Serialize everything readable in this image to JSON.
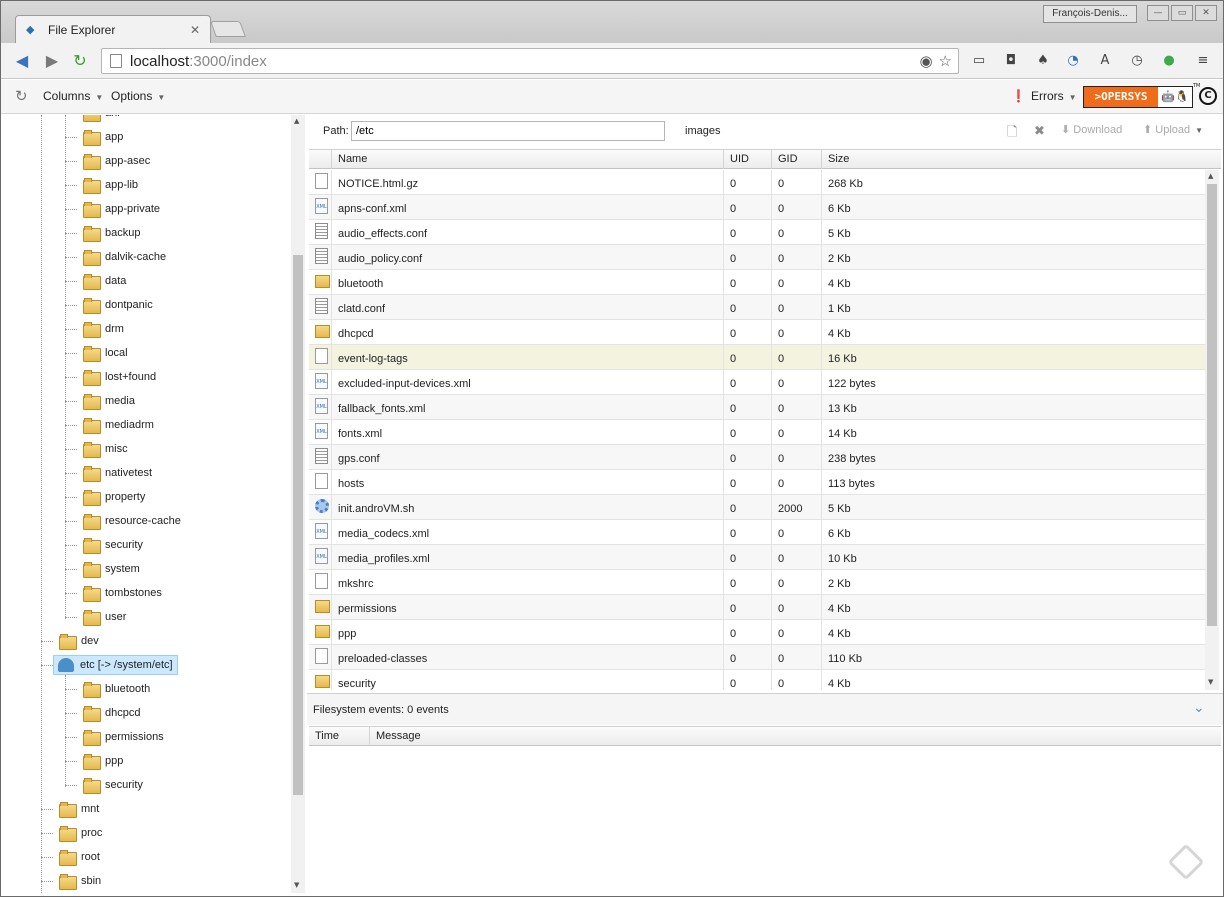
{
  "browser": {
    "tab_title": "File Explorer",
    "tab_close": "✕",
    "profile_name": "François-Denis...",
    "url_host": "localhost",
    "url_rest": ":3000/index"
  },
  "toolbar": {
    "columns_label": "Columns",
    "options_label": "Options",
    "errors_label": "Errors",
    "logo_text": ">OPERSYS",
    "logo_icons": "🤖🐧",
    "copyright": "C",
    "tm": "TM"
  },
  "tree": {
    "items": [
      {
        "label": "anr"
      },
      {
        "label": "app"
      },
      {
        "label": "app-asec"
      },
      {
        "label": "app-lib"
      },
      {
        "label": "app-private"
      },
      {
        "label": "backup"
      },
      {
        "label": "dalvik-cache"
      },
      {
        "label": "data"
      },
      {
        "label": "dontpanic"
      },
      {
        "label": "drm"
      },
      {
        "label": "local"
      },
      {
        "label": "lost+found"
      },
      {
        "label": "media"
      },
      {
        "label": "mediadrm"
      },
      {
        "label": "misc"
      },
      {
        "label": "nativetest"
      },
      {
        "label": "property"
      },
      {
        "label": "resource-cache"
      },
      {
        "label": "security"
      },
      {
        "label": "system"
      },
      {
        "label": "tombstones"
      },
      {
        "label": "user"
      },
      {
        "label": "dev"
      },
      {
        "label": "etc [-> /system/etc]"
      },
      {
        "label": "bluetooth"
      },
      {
        "label": "dhcpcd"
      },
      {
        "label": "permissions"
      },
      {
        "label": "ppp"
      },
      {
        "label": "security"
      },
      {
        "label": "mnt"
      },
      {
        "label": "proc"
      },
      {
        "label": "root"
      },
      {
        "label": "sbin"
      }
    ]
  },
  "path_bar": {
    "label": "Path:",
    "value": "/etc",
    "extra": "images",
    "download": "Download",
    "upload": "Upload"
  },
  "grid": {
    "headers": [
      "Name",
      "UID",
      "GID",
      "Size"
    ],
    "rows": [
      {
        "icon": "file-icon",
        "name": "NOTICE.html.gz",
        "uid": "0",
        "gid": "0",
        "size": "268 Kb"
      },
      {
        "icon": "xml-file-icon",
        "name": "apns-conf.xml",
        "uid": "0",
        "gid": "0",
        "size": "6 Kb"
      },
      {
        "icon": "text-file-icon",
        "name": "audio_effects.conf",
        "uid": "0",
        "gid": "0",
        "size": "5 Kb"
      },
      {
        "icon": "text-file-icon",
        "name": "audio_policy.conf",
        "uid": "0",
        "gid": "0",
        "size": "2 Kb"
      },
      {
        "icon": "folder-icon",
        "name": "bluetooth",
        "uid": "0",
        "gid": "0",
        "size": "4 Kb"
      },
      {
        "icon": "text-file-icon",
        "name": "clatd.conf",
        "uid": "0",
        "gid": "0",
        "size": "1 Kb"
      },
      {
        "icon": "folder-icon",
        "name": "dhcpcd",
        "uid": "0",
        "gid": "0",
        "size": "4 Kb"
      },
      {
        "icon": "file-icon",
        "name": "event-log-tags",
        "uid": "0",
        "gid": "0",
        "size": "16 Kb"
      },
      {
        "icon": "xml-file-icon",
        "name": "excluded-input-devices.xml",
        "uid": "0",
        "gid": "0",
        "size": "122 bytes"
      },
      {
        "icon": "xml-file-icon",
        "name": "fallback_fonts.xml",
        "uid": "0",
        "gid": "0",
        "size": "13 Kb"
      },
      {
        "icon": "xml-file-icon",
        "name": "fonts.xml",
        "uid": "0",
        "gid": "0",
        "size": "14 Kb"
      },
      {
        "icon": "text-file-icon",
        "name": "gps.conf",
        "uid": "0",
        "gid": "0",
        "size": "238 bytes"
      },
      {
        "icon": "file-icon",
        "name": "hosts",
        "uid": "0",
        "gid": "0",
        "size": "113 bytes"
      },
      {
        "icon": "gear-icon",
        "name": "init.androVM.sh",
        "uid": "0",
        "gid": "2000",
        "size": "5 Kb"
      },
      {
        "icon": "xml-file-icon",
        "name": "media_codecs.xml",
        "uid": "0",
        "gid": "0",
        "size": "6 Kb"
      },
      {
        "icon": "xml-file-icon",
        "name": "media_profiles.xml",
        "uid": "0",
        "gid": "0",
        "size": "10 Kb"
      },
      {
        "icon": "file-icon",
        "name": "mkshrc",
        "uid": "0",
        "gid": "0",
        "size": "2 Kb"
      },
      {
        "icon": "folder-icon",
        "name": "permissions",
        "uid": "0",
        "gid": "0",
        "size": "4 Kb"
      },
      {
        "icon": "folder-icon",
        "name": "ppp",
        "uid": "0",
        "gid": "0",
        "size": "4 Kb"
      },
      {
        "icon": "file-icon",
        "name": "preloaded-classes",
        "uid": "0",
        "gid": "0",
        "size": "110 Kb"
      },
      {
        "icon": "folder-icon",
        "name": "security",
        "uid": "0",
        "gid": "0",
        "size": "4 Kb"
      }
    ]
  },
  "events": {
    "label": "Filesystem events: 0 events",
    "headers": [
      "Time",
      "Message"
    ]
  }
}
